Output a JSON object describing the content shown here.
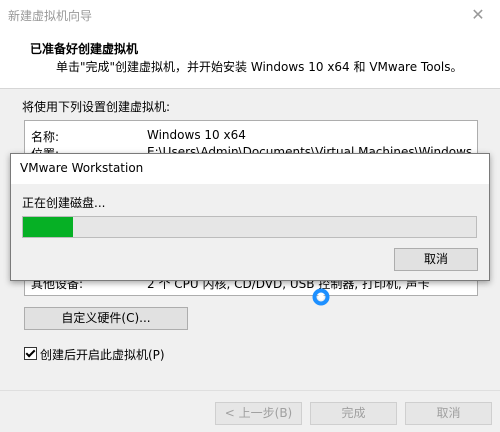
{
  "wizard": {
    "title": "新建虚拟机向导",
    "close_glyph": "✕",
    "header_title": "已准备好创建虚拟机",
    "header_subtitle": "单击\"完成\"创建虚拟机，并开始安装 Windows 10 x64 和 VMware Tools。",
    "summary_caption": "将使用下列设置创建虚拟机:",
    "summary": [
      {
        "key": "名称:",
        "value": "Windows 10 x64"
      },
      {
        "key": "位置:",
        "value": "E:\\Users\\Admin\\Documents\\Virtual Machines\\Windows 10 ..."
      }
    ],
    "summary_peek": {
      "key": "其他设备:",
      "value": "2 个 CPU 内核, CD/DVD, USB 控制器, 打印机, 声卡"
    },
    "customize_button": "自定义硬件(C)...",
    "power_on_checkbox": {
      "label": "创建后开启此虚拟机(P)",
      "checked": true
    },
    "back_button": "< 上一步(B)",
    "finish_button": "完成",
    "cancel_button": "取消"
  },
  "progress_dialog": {
    "title": "VMware Workstation",
    "status": "正在创建磁盘...",
    "progress_fraction": 0.11,
    "progress_color": "#06b025",
    "cancel_button": "取消"
  },
  "cursor": {
    "icon": "busy-spinner-icon",
    "color": "#1e90ff"
  }
}
